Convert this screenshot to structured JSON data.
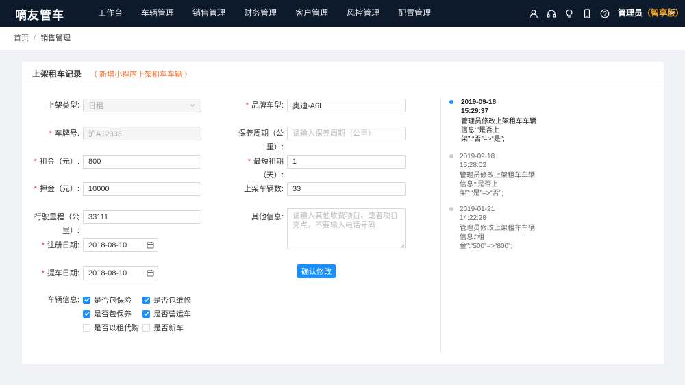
{
  "app": {
    "logo": "嘀友管车"
  },
  "nav": {
    "items": [
      "工作台",
      "车辆管理",
      "销售管理",
      "财务管理",
      "客户管理",
      "风控管理",
      "配置管理"
    ]
  },
  "topbar_icons": [
    "user-icon",
    "headset-icon",
    "bulb-icon",
    "mobile-icon",
    "help-icon"
  ],
  "user": {
    "name": "管理员",
    "version": "（智享版）"
  },
  "breadcrumb": {
    "home": "首页",
    "separator": "/",
    "current": "销售管理"
  },
  "card": {
    "title": "上架租车记录",
    "subtitle": "（ 新增小程序上架租车车辆 ）"
  },
  "form": {
    "listing_type": {
      "label": "上架类型:",
      "value": "日租"
    },
    "plate": {
      "label": "车牌号:",
      "value": "沪A12333"
    },
    "rent": {
      "label": "租金（元）:",
      "value": "800"
    },
    "deposit": {
      "label": "押金（元）:",
      "value": "10000"
    },
    "mileage": {
      "label": "行驶里程（公里）:",
      "value": "33111"
    },
    "reg_date": {
      "label": "注册日期:",
      "value": "2018-08-10"
    },
    "pickup_date": {
      "label": "提车日期:",
      "value": "2018-08-10"
    },
    "brand": {
      "label": "品牌车型:",
      "value": "奥迪-A6L"
    },
    "maintenance": {
      "label": "保养周期（公里）:",
      "placeholder": "请输入保养周期（公里）"
    },
    "min_rent": {
      "label": "最短租期（天）:",
      "value": "1"
    },
    "count": {
      "label": "上架车辆数:",
      "value": "33"
    },
    "other": {
      "label": "其他信息:",
      "placeholder": "请输入其他收费项目、或者项目亮点，不要输入电话号码"
    },
    "vehicle_info": {
      "label": "车辆信息:",
      "options": [
        {
          "label": "是否包保险",
          "checked": true
        },
        {
          "label": "是否包维修",
          "checked": true
        },
        {
          "label": "是否包保养",
          "checked": true
        },
        {
          "label": "是否营运车",
          "checked": true
        },
        {
          "label": "是否以租代购",
          "checked": false
        },
        {
          "label": "是否新车",
          "checked": false
        }
      ]
    },
    "submit": "确认修改"
  },
  "timeline": [
    {
      "date": "2019-09-18",
      "time": "15:29:37",
      "msg": "管理员修改上架租车车辆信息:“是否上架”:“否”=>“是”;",
      "active": true
    },
    {
      "date": "2019-09-18",
      "time": "15:28:02",
      "msg": "管理员修改上架租车车辆信息:“是否上架”:“是”=>“否”;",
      "active": false
    },
    {
      "date": "2019-01-21",
      "time": "14:22:28",
      "msg": "管理员修改上架租车车辆信息:“租金”:“500”=>“800”;",
      "active": false
    }
  ],
  "colors": {
    "primary": "#1890ff",
    "topbar": "#0c1a2c",
    "accent_orange": "#f56c2c",
    "version": "#f5a623",
    "required": "#f5222d"
  }
}
